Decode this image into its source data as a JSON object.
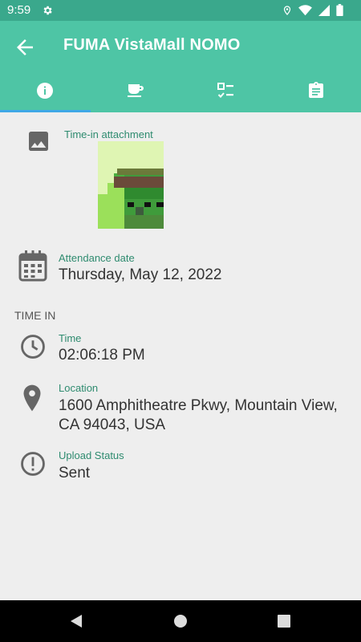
{
  "status_bar": {
    "time": "9:59"
  },
  "app_bar": {
    "title": "FUMA VistaMall NOMO"
  },
  "tabs": [
    {
      "icon": "info-icon",
      "active": true
    },
    {
      "icon": "coffee-icon",
      "active": false
    },
    {
      "icon": "checklist-icon",
      "active": false
    },
    {
      "icon": "clipboard-icon",
      "active": false
    }
  ],
  "attachment": {
    "label": "Time-in attachment"
  },
  "attendance": {
    "label": "Attendance date",
    "value": "Thursday, May 12, 2022"
  },
  "time_in": {
    "section_title": "TIME IN",
    "time_label": "Time",
    "time_value": "02:06:18 PM",
    "location_label": "Location",
    "location_value": "1600 Amphitheatre Pkwy, Mountain View, CA 94043, USA",
    "upload_label": "Upload Status",
    "upload_value": "Sent"
  },
  "colors": {
    "app_bar": "#4ec5a5",
    "status_bar": "#3aa88c",
    "tab_indicator": "#3fa8e6",
    "label": "#2e8b6f"
  }
}
